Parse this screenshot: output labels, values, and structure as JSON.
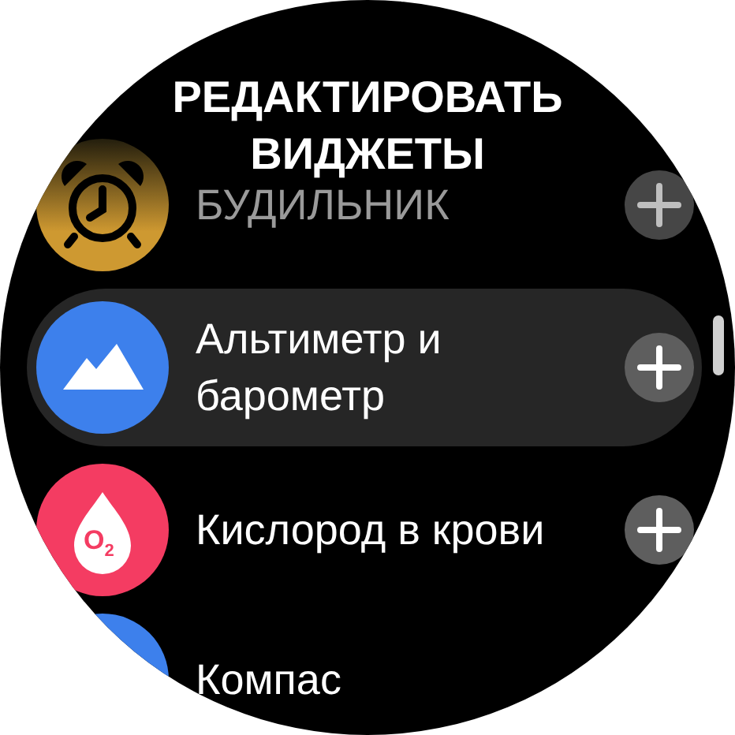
{
  "title": "РЕДАКТИРОВАТЬ ВИДЖЕТЫ",
  "widgets": [
    {
      "kind": "alarm",
      "label": "БУДИЛЬНИК",
      "selected": false,
      "dimmed": true
    },
    {
      "kind": "altimeter",
      "label": "Альтиметр и барометр",
      "selected": true,
      "dimmed": false
    },
    {
      "kind": "oxygen",
      "label": "Кислород в крови",
      "icon_text": "O$_{2}$",
      "selected": false,
      "dimmed": false
    },
    {
      "kind": "compass",
      "label": "Компас",
      "selected": false,
      "dimmed": false
    }
  ]
}
